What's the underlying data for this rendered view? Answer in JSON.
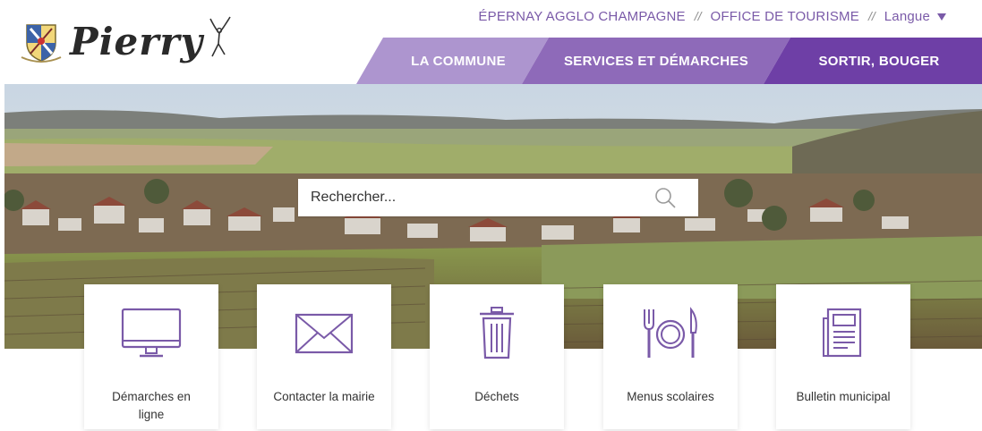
{
  "colors": {
    "accent": "#7a5aa8",
    "nav_light": "#ad95cf",
    "nav_mid": "#8e6ab9",
    "nav_dark": "#6e3fa6",
    "icon_stroke": "#7a5aa8"
  },
  "topbar": {
    "link1": "ÉPERNAY AGGLO CHAMPAGNE",
    "sep1": "//",
    "link2": "OFFICE DE TOURISME",
    "sep2": "//",
    "lang_label": "Langue"
  },
  "logo": {
    "text": "Pierry",
    "crest_icon": "coat-of-arms-icon",
    "dancer_icon": "dancer-icon"
  },
  "nav": {
    "items": [
      {
        "label": "LA COMMUNE"
      },
      {
        "label": "SERVICES ET DÉMARCHES"
      },
      {
        "label": "SORTIR, BOUGER"
      }
    ]
  },
  "search": {
    "placeholder": "Rechercher...",
    "icon": "search-icon"
  },
  "tiles": [
    {
      "label": "Démarches en ligne",
      "icon": "monitor-icon"
    },
    {
      "label": "Contacter la mairie",
      "icon": "envelope-icon"
    },
    {
      "label": "Déchets",
      "icon": "trash-icon"
    },
    {
      "label": "Menus scolaires",
      "icon": "cutlery-plate-icon"
    },
    {
      "label": "Bulletin municipal",
      "icon": "newspaper-icon"
    }
  ]
}
